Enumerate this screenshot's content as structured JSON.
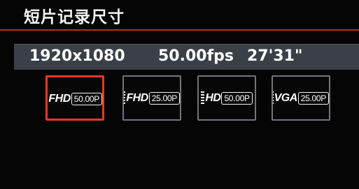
{
  "header": {
    "title": "短片记录尺寸"
  },
  "info": {
    "resolution": "1920x1080",
    "frame_rate": "50.00fps",
    "remaining_time": "27'31\""
  },
  "options": [
    {
      "format": "FHD",
      "rate": "50.00P",
      "selected": true
    },
    {
      "format": "FHD",
      "rate": "25.00P",
      "selected": false
    },
    {
      "format": "HD",
      "rate": "50.00P",
      "selected": false
    },
    {
      "format": "VGA",
      "rate": "25.00P",
      "selected": false
    }
  ],
  "colors": {
    "accent": "#e23a25",
    "divider": "#c8281e",
    "info_bar": "#3a3f48",
    "option_border": "#6f7680"
  }
}
